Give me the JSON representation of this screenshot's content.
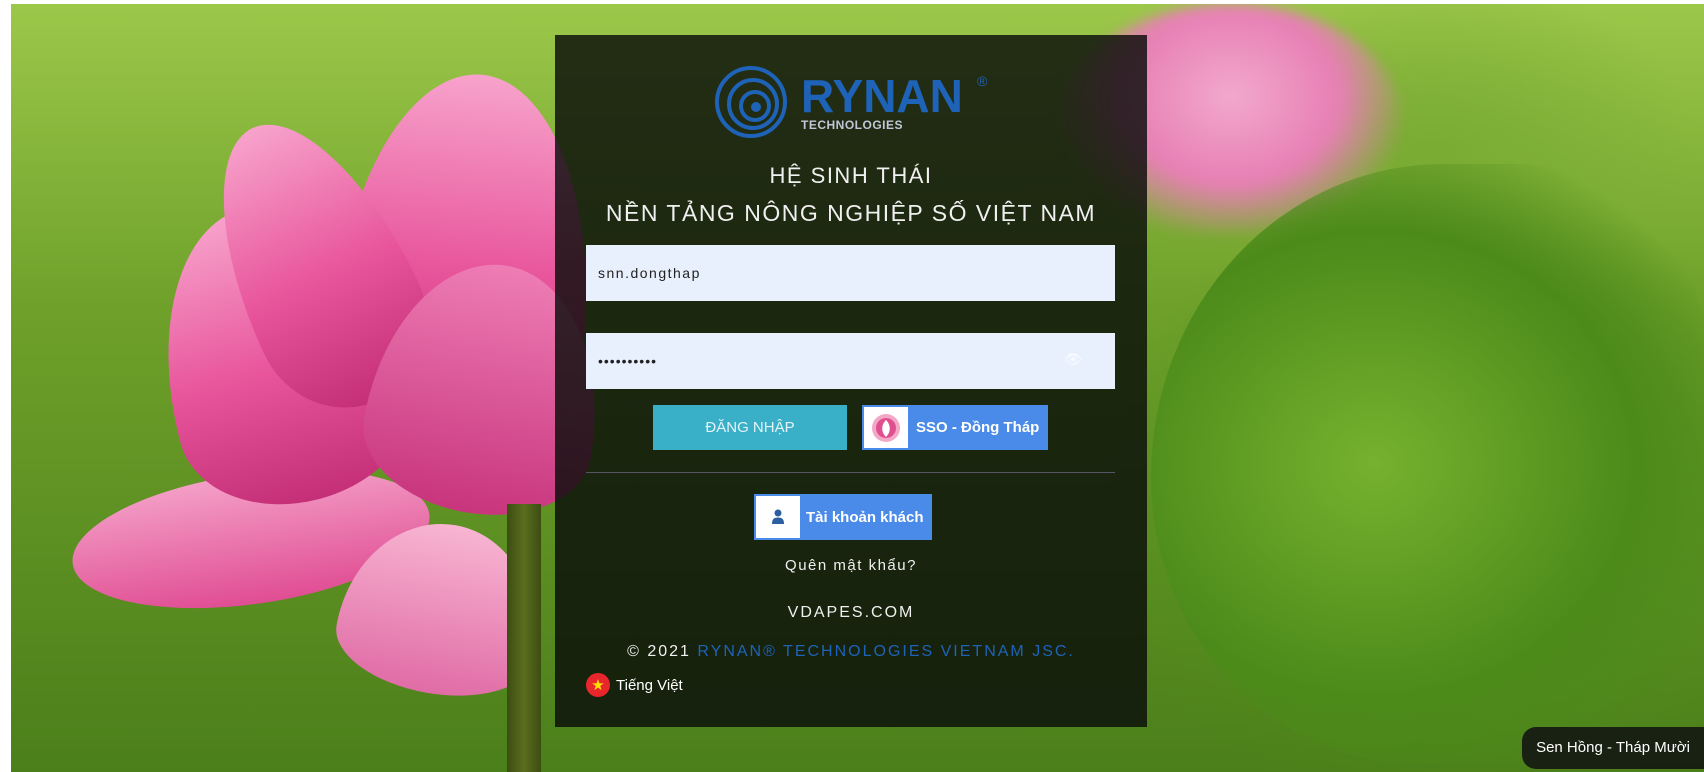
{
  "brand": {
    "name": "RYNAN",
    "sub": "TECHNOLOGIES",
    "reg": "®"
  },
  "header": {
    "line1": "HỆ SINH THÁI",
    "line2": "NỀN TẢNG NÔNG NGHIỆP SỐ VIỆT NAM"
  },
  "form": {
    "username_value": "snn.dongthap",
    "password_value": "••••••••••",
    "login_label": "ĐĂNG NHẬP",
    "sso_label": "SSO - Đồng Tháp",
    "guest_label": "Tài khoản khách",
    "forgot_label": "Quên mật khẩu?"
  },
  "footer": {
    "site": "VDAPES.COM",
    "copyright_year": "© 2021",
    "company": "RYNAN® TECHNOLOGIES VIETNAM JSC.",
    "language": "Tiếng Việt"
  },
  "background": {
    "caption": "Sen Hồng - Tháp Mười"
  },
  "colors": {
    "panel": "#0a0c0a",
    "login_button": "#3ab0c8",
    "sso_button": "#4a8ae8",
    "brand_blue": "#1e63b8",
    "input_bg": "#e8f0fe"
  },
  "icons": {
    "eye": "eye-icon",
    "guest": "user-icon",
    "sso": "sso-logo-icon",
    "flag": "vietnam-flag-icon"
  }
}
